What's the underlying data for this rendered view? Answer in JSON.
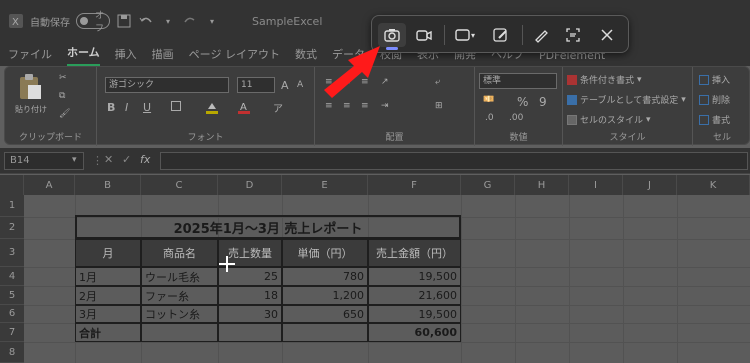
{
  "titlebar": {
    "autosave_label": "自動保存",
    "toggle_label": "オフ",
    "filename": "SampleExcel"
  },
  "menu": {
    "items": [
      "ファイル",
      "ホーム",
      "挿入",
      "描画",
      "ページ レイアウト",
      "数式",
      "データ",
      "校閲",
      "表示",
      "開発",
      "ヘルプ",
      "PDFelement"
    ],
    "active_index": 1
  },
  "ribbon": {
    "clipboard": {
      "paste_label": "貼り付け",
      "group_label": "クリップボード"
    },
    "font": {
      "font_name": "游ゴシック",
      "font_size": "11",
      "bold": "B",
      "italic": "I",
      "underline": "U",
      "grow": "A",
      "shrink": "A",
      "group_label": "フォント"
    },
    "alignment": {
      "group_label": "配置"
    },
    "number": {
      "format": "標準",
      "percent": "%",
      "comma": "9",
      "group_label": "数値"
    },
    "styles": {
      "conditional": "条件付き書式",
      "table_format": "テーブルとして書式設定",
      "cell_styles": "セルのスタイル",
      "group_label": "スタイル"
    },
    "cells": {
      "insert": "挿入",
      "delete": "削除",
      "format": "書式",
      "group_label": "セル"
    }
  },
  "formula_bar": {
    "name_box": "B14",
    "fx": "fx",
    "value": ""
  },
  "columns": [
    "A",
    "B",
    "C",
    "D",
    "E",
    "F",
    "G",
    "H",
    "I",
    "J",
    "K"
  ],
  "rows": [
    "1",
    "2",
    "3",
    "4",
    "5",
    "6",
    "7",
    "8"
  ],
  "sheet": {
    "title": "2025年1月～3月 売上レポート",
    "headers": [
      "月",
      "商品名",
      "売上数量",
      "単価（円）",
      "売上金額（円）"
    ],
    "data": [
      [
        "1月",
        "ウール毛糸",
        "25",
        "780",
        "19,500"
      ],
      [
        "2月",
        "ファー糸",
        "18",
        "1,200",
        "21,600"
      ],
      [
        "3月",
        "コットン糸",
        "30",
        "650",
        "19,500"
      ]
    ],
    "total_label": "合計",
    "total_value": "60,600"
  },
  "snipping_toolbar": {
    "tools": [
      "camera-icon",
      "video-icon",
      "rectangle-mode-icon",
      "edit-icon",
      "pen-icon",
      "text-actions-icon",
      "close-icon"
    ]
  },
  "colors": {
    "accent_green": "#2a9d5a",
    "arrow_red": "#ff1a1a",
    "snip_active": "#7b8cff"
  }
}
